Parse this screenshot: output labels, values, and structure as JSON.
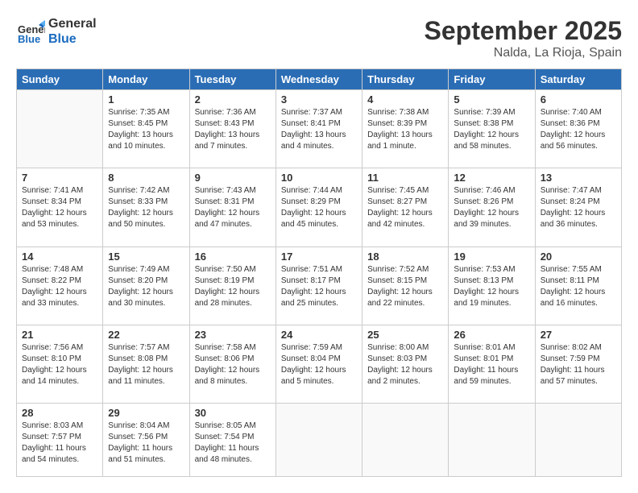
{
  "header": {
    "logo_line1": "General",
    "logo_line2": "Blue",
    "month": "September 2025",
    "location": "Nalda, La Rioja, Spain"
  },
  "weekdays": [
    "Sunday",
    "Monday",
    "Tuesday",
    "Wednesday",
    "Thursday",
    "Friday",
    "Saturday"
  ],
  "weeks": [
    [
      {
        "day": "",
        "info": ""
      },
      {
        "day": "1",
        "info": "Sunrise: 7:35 AM\nSunset: 8:45 PM\nDaylight: 13 hours\nand 10 minutes."
      },
      {
        "day": "2",
        "info": "Sunrise: 7:36 AM\nSunset: 8:43 PM\nDaylight: 13 hours\nand 7 minutes."
      },
      {
        "day": "3",
        "info": "Sunrise: 7:37 AM\nSunset: 8:41 PM\nDaylight: 13 hours\nand 4 minutes."
      },
      {
        "day": "4",
        "info": "Sunrise: 7:38 AM\nSunset: 8:39 PM\nDaylight: 13 hours\nand 1 minute."
      },
      {
        "day": "5",
        "info": "Sunrise: 7:39 AM\nSunset: 8:38 PM\nDaylight: 12 hours\nand 58 minutes."
      },
      {
        "day": "6",
        "info": "Sunrise: 7:40 AM\nSunset: 8:36 PM\nDaylight: 12 hours\nand 56 minutes."
      }
    ],
    [
      {
        "day": "7",
        "info": "Sunrise: 7:41 AM\nSunset: 8:34 PM\nDaylight: 12 hours\nand 53 minutes."
      },
      {
        "day": "8",
        "info": "Sunrise: 7:42 AM\nSunset: 8:33 PM\nDaylight: 12 hours\nand 50 minutes."
      },
      {
        "day": "9",
        "info": "Sunrise: 7:43 AM\nSunset: 8:31 PM\nDaylight: 12 hours\nand 47 minutes."
      },
      {
        "day": "10",
        "info": "Sunrise: 7:44 AM\nSunset: 8:29 PM\nDaylight: 12 hours\nand 45 minutes."
      },
      {
        "day": "11",
        "info": "Sunrise: 7:45 AM\nSunset: 8:27 PM\nDaylight: 12 hours\nand 42 minutes."
      },
      {
        "day": "12",
        "info": "Sunrise: 7:46 AM\nSunset: 8:26 PM\nDaylight: 12 hours\nand 39 minutes."
      },
      {
        "day": "13",
        "info": "Sunrise: 7:47 AM\nSunset: 8:24 PM\nDaylight: 12 hours\nand 36 minutes."
      }
    ],
    [
      {
        "day": "14",
        "info": "Sunrise: 7:48 AM\nSunset: 8:22 PM\nDaylight: 12 hours\nand 33 minutes."
      },
      {
        "day": "15",
        "info": "Sunrise: 7:49 AM\nSunset: 8:20 PM\nDaylight: 12 hours\nand 30 minutes."
      },
      {
        "day": "16",
        "info": "Sunrise: 7:50 AM\nSunset: 8:19 PM\nDaylight: 12 hours\nand 28 minutes."
      },
      {
        "day": "17",
        "info": "Sunrise: 7:51 AM\nSunset: 8:17 PM\nDaylight: 12 hours\nand 25 minutes."
      },
      {
        "day": "18",
        "info": "Sunrise: 7:52 AM\nSunset: 8:15 PM\nDaylight: 12 hours\nand 22 minutes."
      },
      {
        "day": "19",
        "info": "Sunrise: 7:53 AM\nSunset: 8:13 PM\nDaylight: 12 hours\nand 19 minutes."
      },
      {
        "day": "20",
        "info": "Sunrise: 7:55 AM\nSunset: 8:11 PM\nDaylight: 12 hours\nand 16 minutes."
      }
    ],
    [
      {
        "day": "21",
        "info": "Sunrise: 7:56 AM\nSunset: 8:10 PM\nDaylight: 12 hours\nand 14 minutes."
      },
      {
        "day": "22",
        "info": "Sunrise: 7:57 AM\nSunset: 8:08 PM\nDaylight: 12 hours\nand 11 minutes."
      },
      {
        "day": "23",
        "info": "Sunrise: 7:58 AM\nSunset: 8:06 PM\nDaylight: 12 hours\nand 8 minutes."
      },
      {
        "day": "24",
        "info": "Sunrise: 7:59 AM\nSunset: 8:04 PM\nDaylight: 12 hours\nand 5 minutes."
      },
      {
        "day": "25",
        "info": "Sunrise: 8:00 AM\nSunset: 8:03 PM\nDaylight: 12 hours\nand 2 minutes."
      },
      {
        "day": "26",
        "info": "Sunrise: 8:01 AM\nSunset: 8:01 PM\nDaylight: 11 hours\nand 59 minutes."
      },
      {
        "day": "27",
        "info": "Sunrise: 8:02 AM\nSunset: 7:59 PM\nDaylight: 11 hours\nand 57 minutes."
      }
    ],
    [
      {
        "day": "28",
        "info": "Sunrise: 8:03 AM\nSunset: 7:57 PM\nDaylight: 11 hours\nand 54 minutes."
      },
      {
        "day": "29",
        "info": "Sunrise: 8:04 AM\nSunset: 7:56 PM\nDaylight: 11 hours\nand 51 minutes."
      },
      {
        "day": "30",
        "info": "Sunrise: 8:05 AM\nSunset: 7:54 PM\nDaylight: 11 hours\nand 48 minutes."
      },
      {
        "day": "",
        "info": ""
      },
      {
        "day": "",
        "info": ""
      },
      {
        "day": "",
        "info": ""
      },
      {
        "day": "",
        "info": ""
      }
    ]
  ]
}
